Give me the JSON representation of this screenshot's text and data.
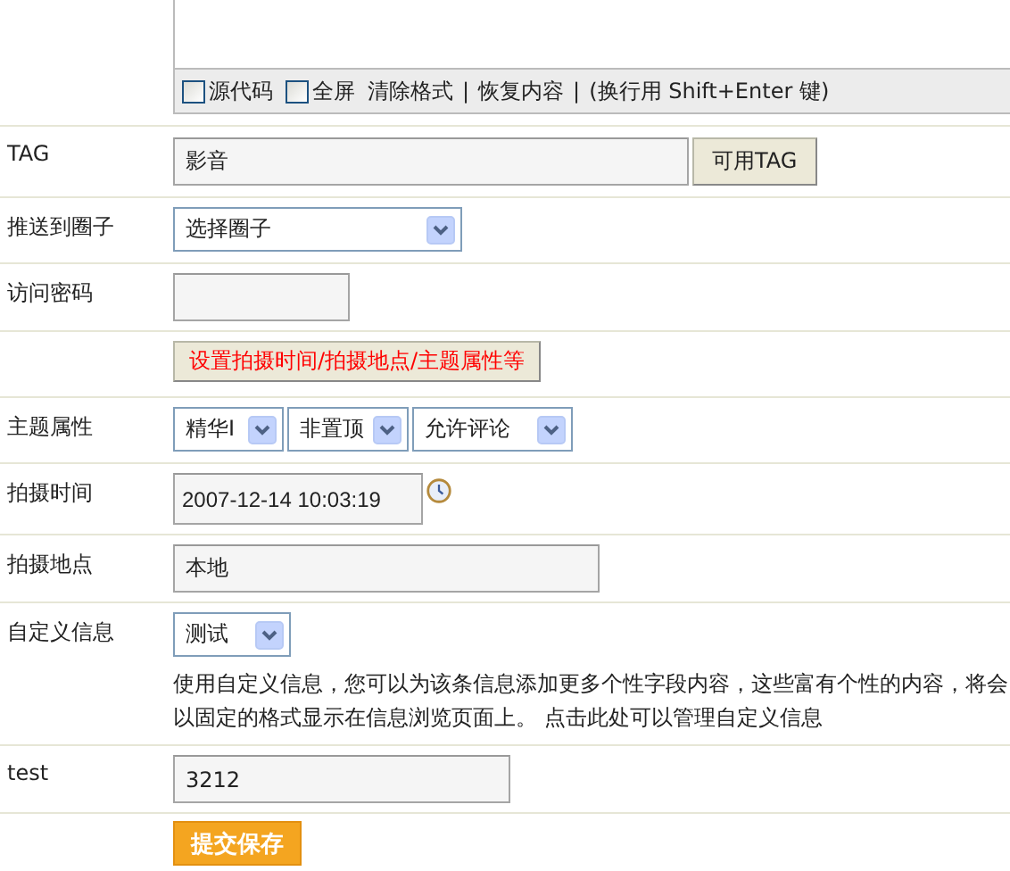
{
  "editor": {
    "toolbar": [
      {
        "kind": "checkbox",
        "label": "源代码",
        "checked": false
      },
      {
        "kind": "checkbox",
        "label": "全屏",
        "checked": false
      },
      {
        "kind": "link",
        "label": "清除格式"
      },
      {
        "kind": "separator",
        "label": "|"
      },
      {
        "kind": "link",
        "label": "恢复内容"
      },
      {
        "kind": "separator",
        "label": "|"
      },
      {
        "kind": "hint",
        "label": "(换行用 Shift+Enter 键)"
      }
    ]
  },
  "rows": [
    {
      "kind": "tag",
      "label": "TAG",
      "value": "影音",
      "button": "可用TAG"
    },
    {
      "kind": "select",
      "label": "推送到圈子",
      "selects": [
        "选择圈子"
      ]
    },
    {
      "kind": "password",
      "label": "访问密码",
      "value": ""
    },
    {
      "kind": "button",
      "label": "",
      "button": "设置拍摄时间/拍摄地点/主题属性等"
    },
    {
      "kind": "select",
      "label": "主题属性",
      "selects": [
        "精华I",
        "非置顶",
        "允许评论"
      ]
    },
    {
      "kind": "datetime",
      "label": "拍摄时间",
      "value": "2007-12-14 10:03:19"
    },
    {
      "kind": "text",
      "label": "拍摄地点",
      "value": "本地"
    },
    {
      "kind": "custom",
      "label": "自定义信息",
      "selects": [
        "测试"
      ],
      "note": "使用自定义信息，您可以为该条信息添加更多个性字段内容，这些富有个性的内容，将会以固定的格式显示在信息浏览页面上。 点击此处可以管理自定义信息"
    },
    {
      "kind": "short",
      "label": "test",
      "value": "3212"
    },
    {
      "kind": "submit",
      "label": "",
      "button": "提交保存"
    }
  ]
}
